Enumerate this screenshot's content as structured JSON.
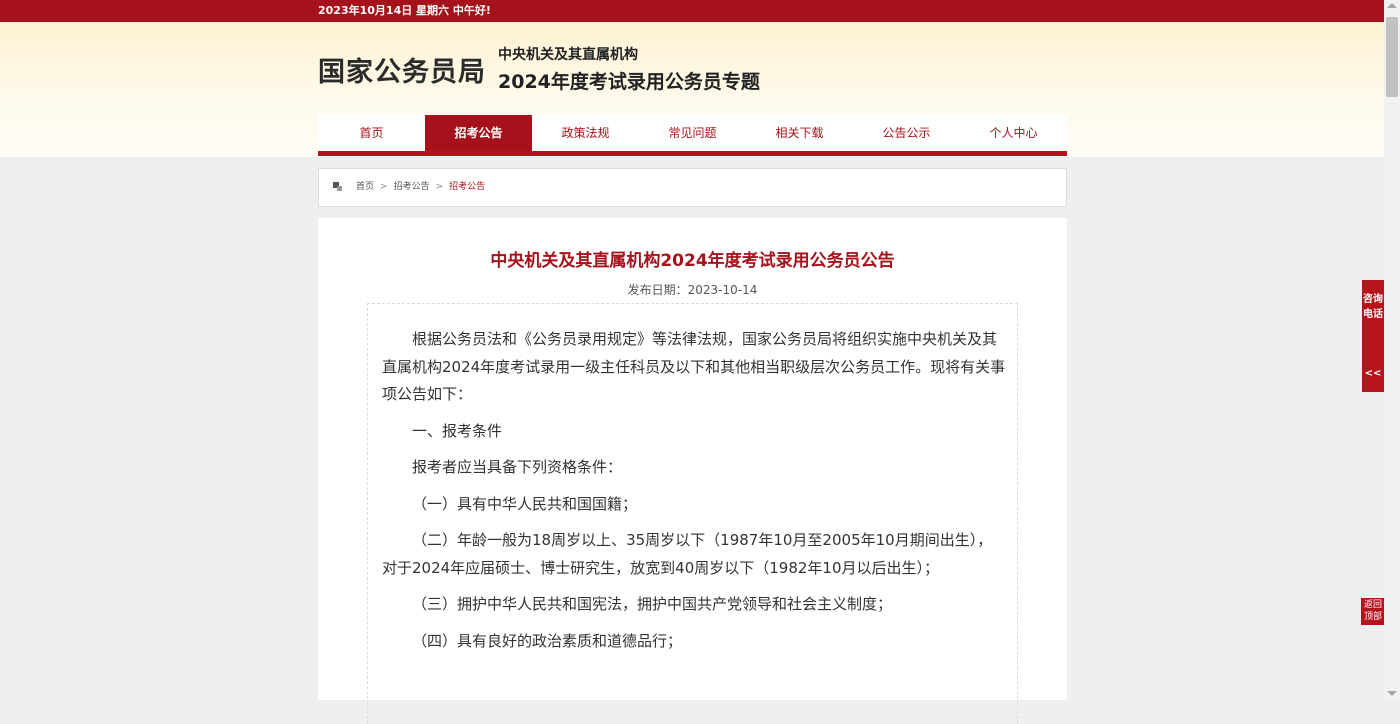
{
  "topbar": {
    "date_text": "2023年10月14日  星期六  中午好!"
  },
  "header": {
    "site_name": "国家公务员局",
    "sub_line1": "中央机关及其直属机构",
    "sub_line2": "2024年度考试录用公务员专题"
  },
  "nav": {
    "items": [
      {
        "label": "首页"
      },
      {
        "label": "招考公告",
        "active": true
      },
      {
        "label": "政策法规"
      },
      {
        "label": "常见问题"
      },
      {
        "label": "相关下载"
      },
      {
        "label": "公告公示"
      },
      {
        "label": "个人中心"
      }
    ]
  },
  "breadcrumb": {
    "icon": "breadcrumb-icon",
    "items": [
      "首页",
      "招考公告",
      "招考公告"
    ],
    "separator": ">"
  },
  "article": {
    "title": "中央机关及其直属机构2024年度考试录用公务员公告",
    "publish_date": "发布日期：2023-10-14",
    "paragraphs": [
      "根据公务员法和《公务员录用规定》等法律法规，国家公务员局将组织实施中央机关及其直属机构2024年度考试录用一级主任科员及以下和其他相当职级层次公务员工作。现将有关事项公告如下：",
      "一、报考条件",
      "报考者应当具备下列资格条件：",
      "（一）具有中华人民共和国国籍；",
      "（二）年龄一般为18周岁以上、35周岁以下（1987年10月至2005年10月期间出生），对于2024年应届硕士、博士研究生，放宽到40周岁以下（1982年10月以后出生）；",
      "（三）拥护中华人民共和国宪法，拥护中国共产党领导和社会主义制度；",
      "（四）具有良好的政治素质和道德品行；"
    ]
  },
  "side": {
    "consult_label": "咨询电话",
    "collapse_label": "<<",
    "back_top_label_1": "返回",
    "back_top_label_2": "顶部"
  },
  "colors": {
    "brand_red": "#a6121b",
    "header_bg": "#fdf3d2",
    "page_bg": "#efefef"
  }
}
